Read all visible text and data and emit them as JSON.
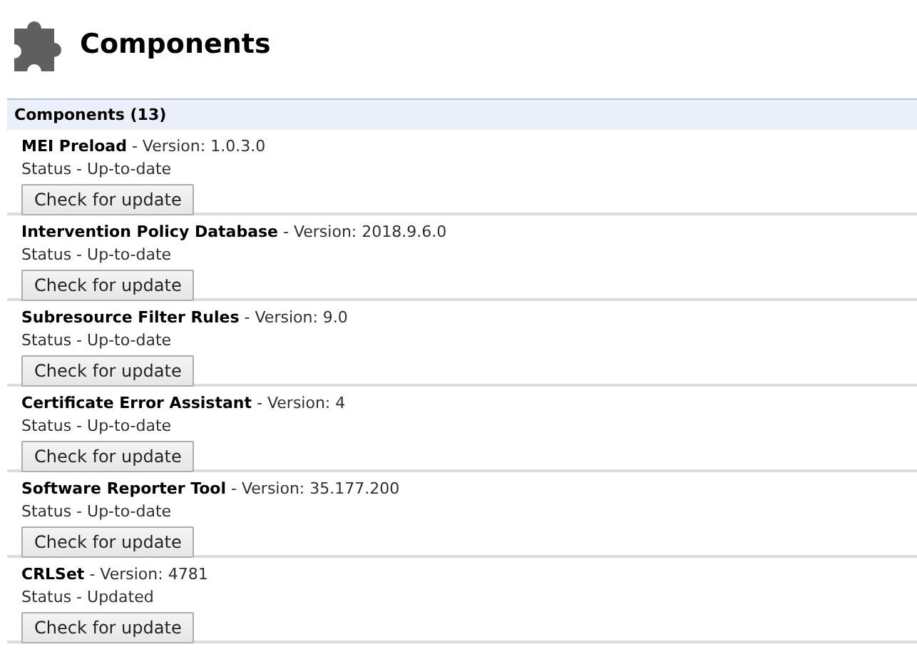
{
  "page": {
    "title": "Components"
  },
  "section": {
    "heading": "Components (13)"
  },
  "components": [
    {
      "title": "**MEI Preload** - Version: 1.0.3.0",
      "status": "Status - Up-to-date",
      "button": "Check for update"
    },
    {
      "title": "**Intervention Policy Database** - Version: 2018.9.6.0",
      "status": "Status - Up-to-date",
      "button": "Check for update"
    },
    {
      "title": "**Subresource Filter Rules** - Version: 9.0",
      "status": "Status - Up-to-date",
      "button": "Check for update"
    },
    {
      "title": "**Certificate Error Assistant** - Version: 4",
      "status": "Status - Up-to-date",
      "button": "Check for update"
    },
    {
      "title": "**Software Reporter Tool** - Version: 35.177.200",
      "status": "Status - Up-to-date",
      "button": "Check for update"
    },
    {
      "title": "**CRLSet** - Version: 4781",
      "status": "Status - Updated",
      "button": "Check for update"
    }
  ]
}
